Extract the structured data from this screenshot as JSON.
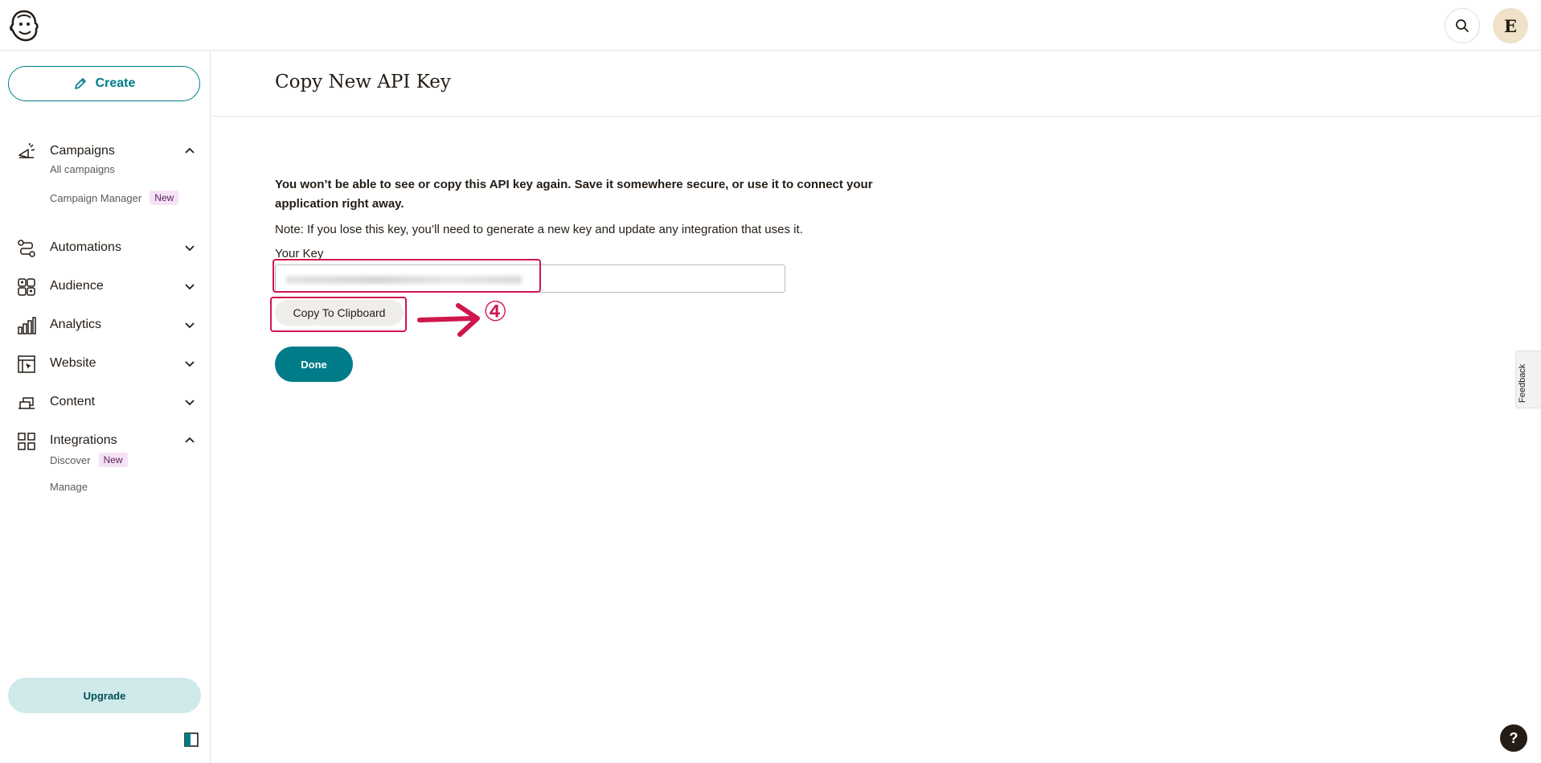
{
  "header": {
    "logo_icon": "mailchimp-freddie-logo",
    "search_icon": "search-icon",
    "avatar_initial": "E"
  },
  "sidebar": {
    "create_label": "Create",
    "items": [
      {
        "label": "Campaigns",
        "icon": "megaphone-icon",
        "expanded": true,
        "children": [
          {
            "label": "All campaigns"
          },
          {
            "label": "Campaign Manager",
            "badge": "New"
          }
        ]
      },
      {
        "label": "Automations",
        "icon": "automations-icon",
        "expanded": false
      },
      {
        "label": "Audience",
        "icon": "audience-icon",
        "expanded": false
      },
      {
        "label": "Analytics",
        "icon": "analytics-icon",
        "expanded": false
      },
      {
        "label": "Website",
        "icon": "website-icon",
        "expanded": false
      },
      {
        "label": "Content",
        "icon": "content-icon",
        "expanded": false
      },
      {
        "label": "Integrations",
        "icon": "integrations-icon",
        "expanded": true,
        "children": [
          {
            "label": "Discover",
            "badge": "New"
          },
          {
            "label": "Manage"
          }
        ]
      }
    ],
    "upgrade_label": "Upgrade"
  },
  "main": {
    "title": "Copy New API Key",
    "warning": "You won’t be able to see or copy this API key again. Save it somewhere secure, or use it to connect your application right away.",
    "note": "Note: If you lose this key, you’ll need to generate a new key and update any integration that uses it.",
    "key_label": "Your Key",
    "copy_button": "Copy To Clipboard",
    "done_button": "Done",
    "annotation_step": "④"
  },
  "colors": {
    "accent": "#007c89",
    "annotation": "#d0164d",
    "upgrade_bg": "#d0e9ea"
  },
  "feedback_label": "Feedback",
  "help_label": "?"
}
